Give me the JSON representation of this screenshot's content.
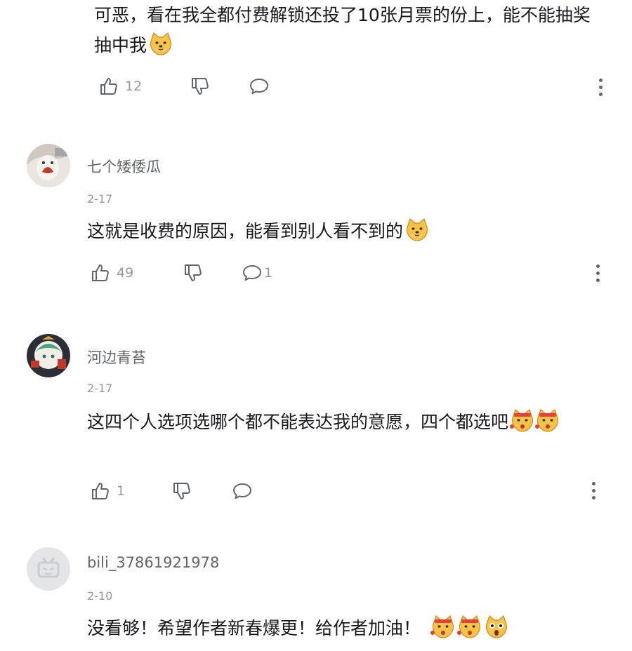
{
  "comments": [
    {
      "text": "可恶，看在我全都付费解锁还投了10张月票的份上，能不能抽奖抽中我",
      "likes": "12",
      "replies": ""
    },
    {
      "username": "七个矮倭瓜",
      "date": "2-17",
      "text": "这就是收费的原因，能看到别人看不到的",
      "likes": "49",
      "replies": "1"
    },
    {
      "username": "河边青苔",
      "date": "2-17",
      "text": "这四个人选项选哪个都不能表达我的意愿，四个都选吧",
      "likes": "1",
      "replies": ""
    },
    {
      "username": "bili_37861921978",
      "date": "2-10",
      "text": "没看够！希望作者新春爆更！给作者加油！",
      "likes": "",
      "replies": ""
    }
  ],
  "icons": {
    "like": "thumbs-up-icon",
    "dislike": "thumbs-down-icon",
    "reply": "reply-bubble-icon",
    "more": "more-vertical-icon",
    "emoji": "doge-emoji-icon"
  },
  "colors": {
    "text": "#18191c",
    "secondary": "#61666d",
    "muted": "#9499a0",
    "emoji_yellow": "#f5c24a"
  }
}
